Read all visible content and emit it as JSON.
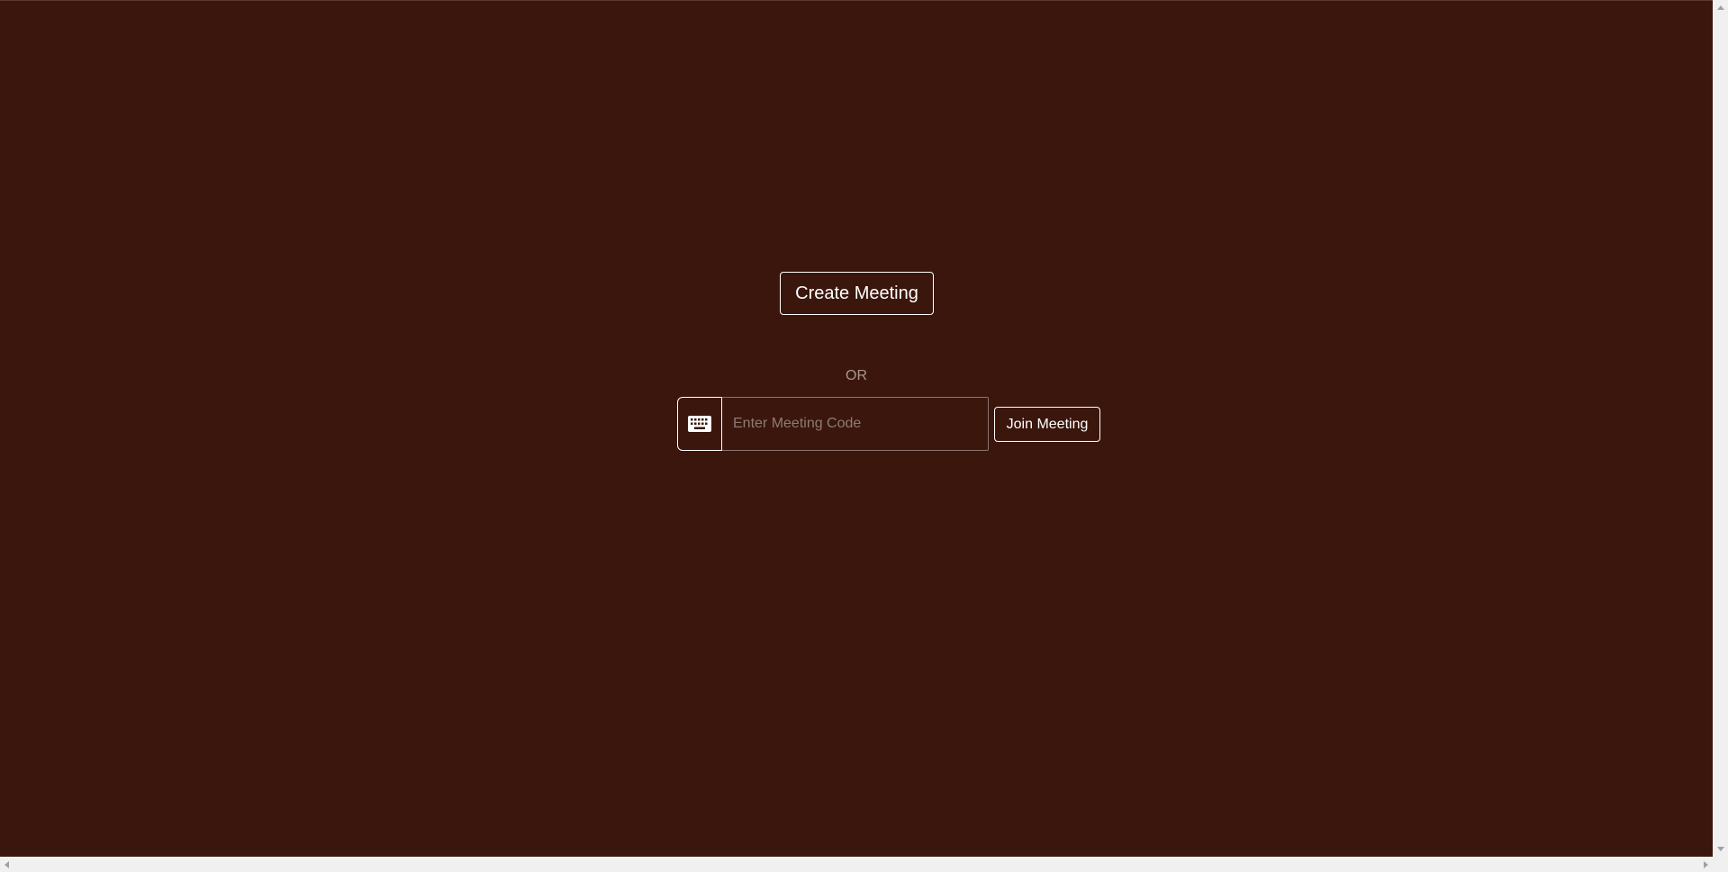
{
  "main": {
    "create_button_label": "Create Meeting",
    "separator_text": "OR",
    "meeting_code": {
      "placeholder": "Enter Meeting Code",
      "value": "",
      "icon": "keyboard-icon"
    },
    "join_button_label": "Join Meeting"
  },
  "colors": {
    "background": "#3a160c",
    "button_border": "#ffffff",
    "text": "#ffffff",
    "muted_text": "#a8968f"
  }
}
